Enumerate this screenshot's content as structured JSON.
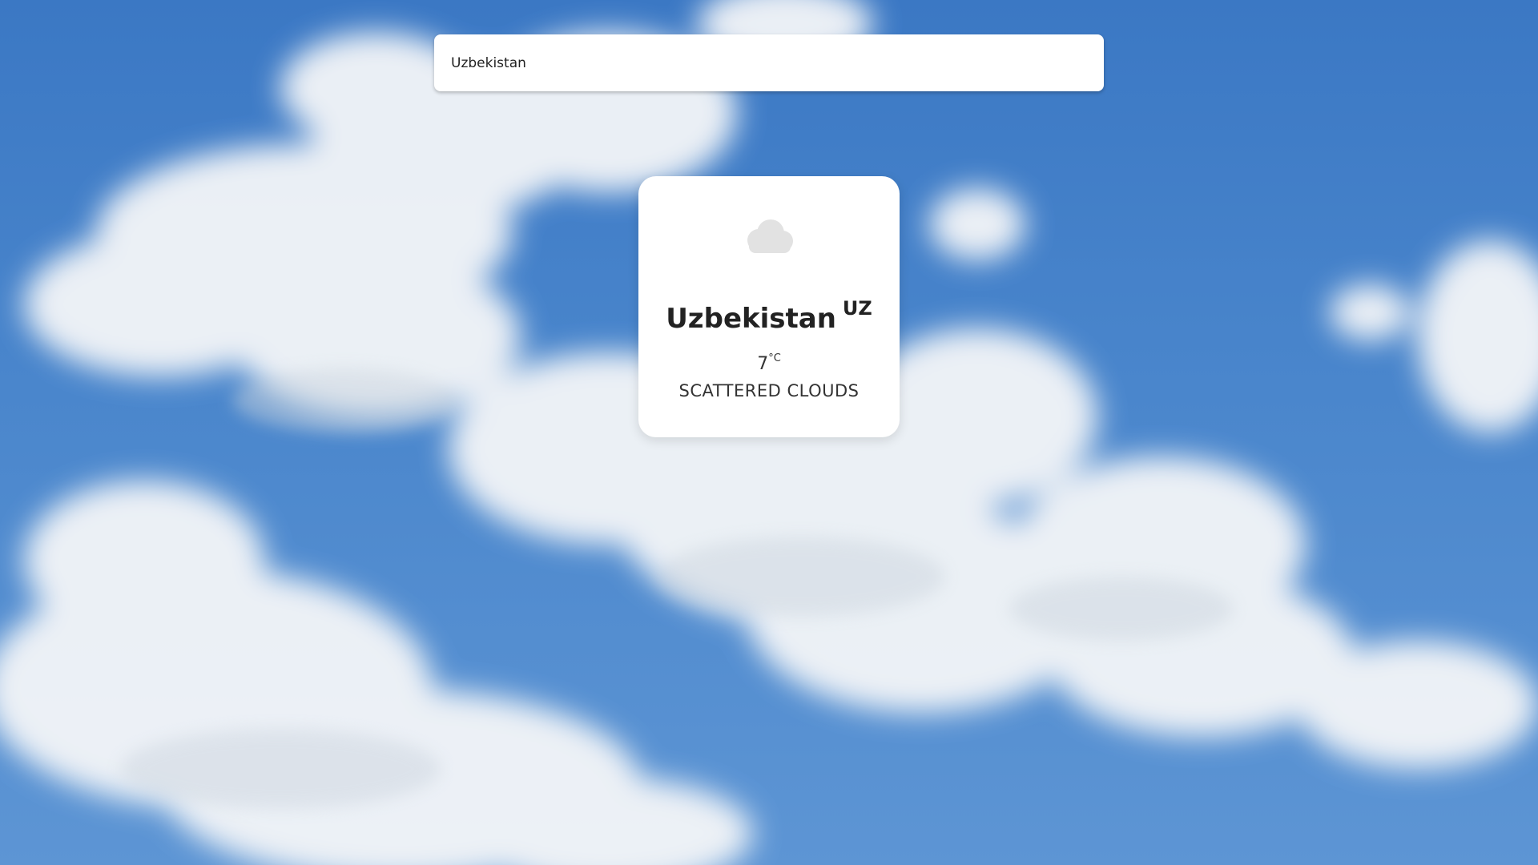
{
  "search": {
    "value": "Uzbekistan",
    "placeholder": ""
  },
  "weather": {
    "city": "Uzbekistan",
    "country_code": "UZ",
    "temperature": "7",
    "unit": "°C",
    "description": "SCATTERED CLOUDS",
    "icon": "cloud-icon"
  },
  "colors": {
    "sky": "#3b78c4",
    "card": "#ffffff",
    "text": "#222222"
  }
}
